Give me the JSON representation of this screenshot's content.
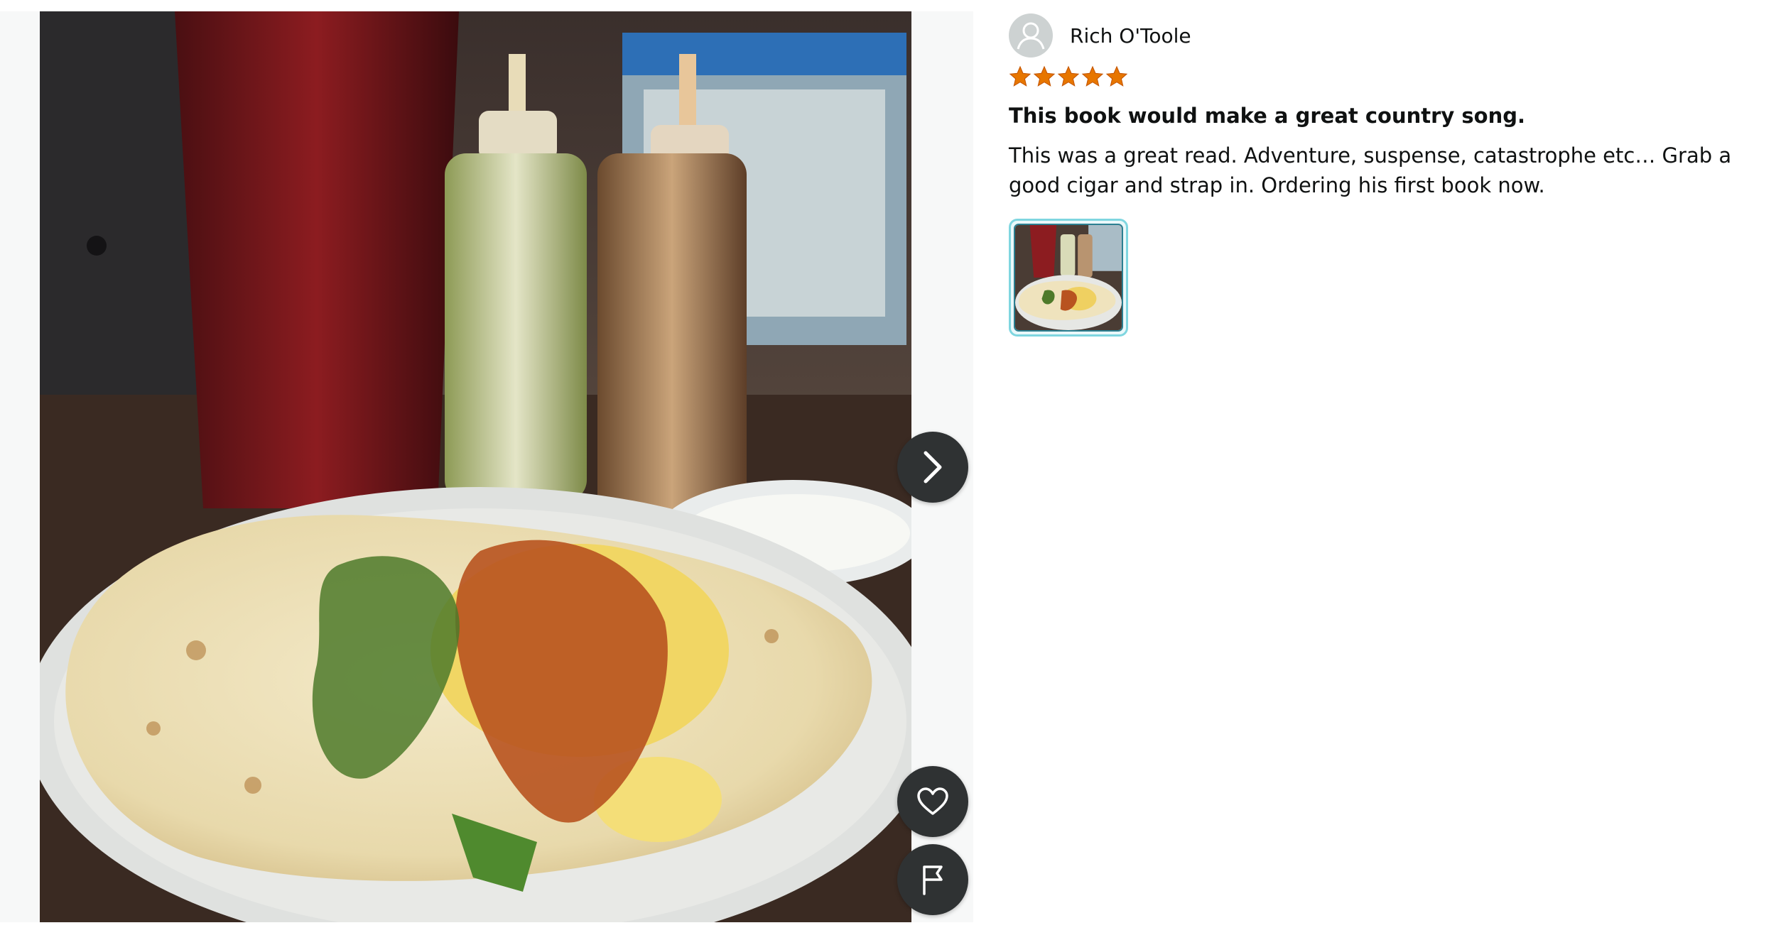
{
  "media": {
    "photo_alt": "Customer photo",
    "next_icon": "chevron-right-icon",
    "like_icon": "heart-icon",
    "flag_icon": "flag-icon"
  },
  "review": {
    "reviewer_name": "Rich O'Toole",
    "avatar_icon": "user-icon",
    "rating": 5,
    "rating_max": 5,
    "star_color": "#e77600",
    "title": "This book would make a great country song.",
    "body": "This was a great read. Adventure, suspense, catastrophe etc… Grab a good cigar and strap in. Ordering his first book now.",
    "thumbnail_alt": "Review image thumbnail"
  },
  "colors": {
    "accent_thumb_border": "#7fd6e0",
    "button_bg": "#2f3233"
  }
}
